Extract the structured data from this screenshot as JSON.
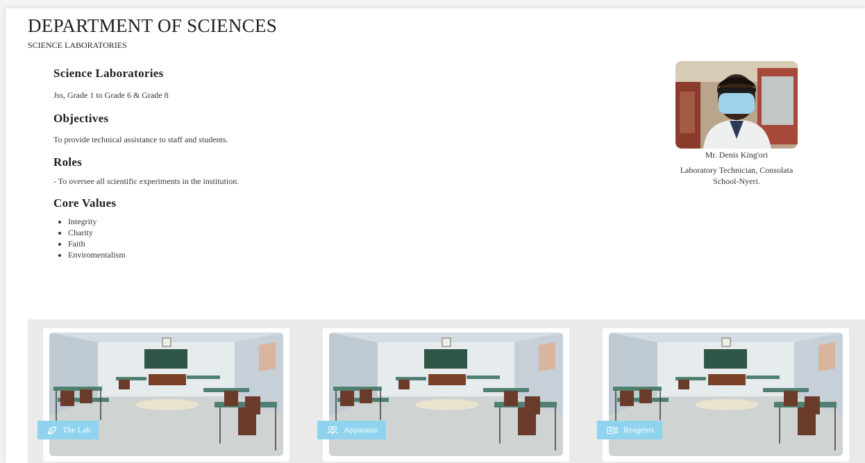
{
  "header": {
    "title": "DEPARTMENT OF SCIENCES",
    "subtitle": "SCIENCE LABORATORIES"
  },
  "content": {
    "lab_heading": "Science Laboratories",
    "lab_text": "Jss, Grade 1 to Grade 6 & Grade 8",
    "objectives_heading": "Objectives",
    "objectives_text": "To provide technical assistance to staff and students.",
    "roles_heading": "Roles",
    "roles_text": "- To oversee all scientific experiments in the institution.",
    "core_values_heading": "Core Values",
    "core_values": [
      "Integrity",
      "Charity",
      "Faith",
      "Enviromentalism"
    ]
  },
  "profile": {
    "name": "Mr. Denis King'ori",
    "role_line1": "Laboratory Technician, Consolata",
    "role_line2": "School-Nyeri."
  },
  "gallery": {
    "cards": [
      {
        "label": "The Lab",
        "icon": "leaf-icon"
      },
      {
        "label": "Apparatus",
        "icon": "users-icon"
      },
      {
        "label": "Reagents",
        "icon": "video-icon"
      }
    ]
  },
  "colors": {
    "button_bg": "#8fd3ee",
    "gallery_bg": "#eaeaea"
  }
}
